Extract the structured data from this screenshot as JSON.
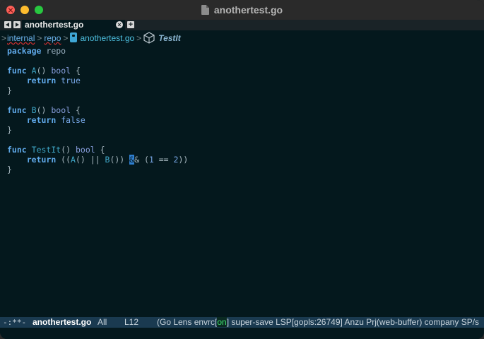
{
  "window": {
    "title": "anothertest.go"
  },
  "tabs": {
    "active_label": "anothertest.go",
    "close_glyph": "×",
    "add_glyph": "+"
  },
  "breadcrumb": {
    "items": [
      "internal",
      "repo",
      "anothertest.go",
      "TestIt"
    ],
    "separator": ">"
  },
  "code": {
    "lines": [
      [
        {
          "c": "kw",
          "t": "package"
        },
        {
          "c": "plain",
          "t": " "
        },
        {
          "c": "id",
          "t": "repo"
        }
      ],
      [],
      [
        {
          "c": "kw",
          "t": "func"
        },
        {
          "c": "plain",
          "t": " "
        },
        {
          "c": "fn",
          "t": "A"
        },
        {
          "c": "plain",
          "t": "() "
        },
        {
          "c": "ty",
          "t": "bool"
        },
        {
          "c": "plain",
          "t": " {"
        }
      ],
      [
        {
          "c": "plain",
          "t": "    "
        },
        {
          "c": "kw",
          "t": "return"
        },
        {
          "c": "plain",
          "t": " "
        },
        {
          "c": "lit",
          "t": "true"
        }
      ],
      [
        {
          "c": "plain",
          "t": "}"
        }
      ],
      [],
      [
        {
          "c": "kw",
          "t": "func"
        },
        {
          "c": "plain",
          "t": " "
        },
        {
          "c": "fn",
          "t": "B"
        },
        {
          "c": "plain",
          "t": "() "
        },
        {
          "c": "ty",
          "t": "bool"
        },
        {
          "c": "plain",
          "t": " {"
        }
      ],
      [
        {
          "c": "plain",
          "t": "    "
        },
        {
          "c": "kw",
          "t": "return"
        },
        {
          "c": "plain",
          "t": " "
        },
        {
          "c": "lit",
          "t": "false"
        }
      ],
      [
        {
          "c": "plain",
          "t": "}"
        }
      ],
      [],
      [
        {
          "c": "kw",
          "t": "func"
        },
        {
          "c": "plain",
          "t": " "
        },
        {
          "c": "fn",
          "t": "TestIt"
        },
        {
          "c": "plain",
          "t": "() "
        },
        {
          "c": "ty",
          "t": "bool"
        },
        {
          "c": "plain",
          "t": " {"
        }
      ],
      [
        {
          "c": "plain",
          "t": "    "
        },
        {
          "c": "kw",
          "t": "return"
        },
        {
          "c": "plain",
          "t": " (("
        },
        {
          "c": "fn",
          "t": "A"
        },
        {
          "c": "plain",
          "t": "() || "
        },
        {
          "c": "fn",
          "t": "B"
        },
        {
          "c": "plain",
          "t": "()) "
        },
        {
          "c": "cursor",
          "t": "&"
        },
        {
          "c": "plain",
          "t": "& ("
        },
        {
          "c": "lit",
          "t": "1"
        },
        {
          "c": "plain",
          "t": " == "
        },
        {
          "c": "lit",
          "t": "2"
        },
        {
          "c": "plain",
          "t": "))"
        }
      ],
      [
        {
          "c": "plain",
          "t": "}"
        }
      ]
    ]
  },
  "status": {
    "modified": "-:**-",
    "buffer": "anothertest.go",
    "position": "All",
    "line": "L12",
    "modes_prefix": "(Go Lens envrc[",
    "modes_on": "on",
    "modes_suffix": "] super-save LSP[gopls:26749] Anzu Prj(web-buffer) company SP/s"
  },
  "colors": {
    "background": "#04181d",
    "status_bar": "#1a3a50",
    "keyword": "#5fa8e8",
    "cursor": "#2f7fd0",
    "envrc_on": "#3fe070"
  }
}
